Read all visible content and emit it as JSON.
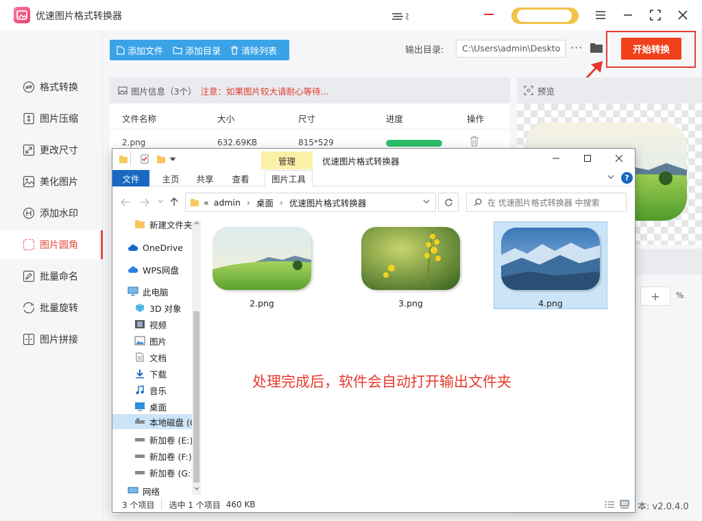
{
  "app": {
    "title": "优速图片格式转换器",
    "version_label": "本: v2.0.4.0"
  },
  "sidebar": {
    "items": [
      {
        "label": "格式转换",
        "icon": "convert-icon"
      },
      {
        "label": "图片压缩",
        "icon": "compress-icon"
      },
      {
        "label": "更改尺寸",
        "icon": "resize-icon"
      },
      {
        "label": "美化图片",
        "icon": "beautify-icon"
      },
      {
        "label": "添加水印",
        "icon": "watermark-icon"
      },
      {
        "label": "图片圆角",
        "icon": "round-corner-icon",
        "active": true
      },
      {
        "label": "批量命名",
        "icon": "rename-icon"
      },
      {
        "label": "批量旋转",
        "icon": "rotate-icon"
      },
      {
        "label": "图片拼接",
        "icon": "stitch-icon"
      }
    ]
  },
  "toolbar": {
    "add_file": "添加文件",
    "add_folder": "添加目录",
    "clear_list": "清除列表",
    "output_label": "输出目录:",
    "output_path": "C:\\Users\\admin\\Deskto",
    "more": "···",
    "start": "开始转换"
  },
  "file_table": {
    "info_title": "图片信息（3个）",
    "warning": "注意：如果图片较大请耐心等待...",
    "headers": [
      "文件名称",
      "大小",
      "尺寸",
      "进度",
      "操作"
    ],
    "rows": [
      {
        "name": "2.png",
        "size": "632.69KB",
        "dimensions": "815*529",
        "progress": 1.0
      }
    ]
  },
  "preview": {
    "title": "预览",
    "zoom_plus": "+",
    "zoom_unit": "%"
  },
  "explorer": {
    "manage_tab": "管理",
    "window_title": "优速图片格式转换器",
    "tabs": [
      "文件",
      "主页",
      "共享",
      "查看",
      "图片工具"
    ],
    "breadcrumb": [
      "«",
      "admin",
      "桌面",
      "优速图片格式转换器"
    ],
    "search_placeholder": "在 优速图片格式转换器 中搜索",
    "nav": [
      "新建文件夹",
      "OneDrive",
      "WPS网盘",
      "此电脑",
      "3D 对象",
      "视频",
      "图片",
      "文档",
      "下载",
      "音乐",
      "桌面",
      "本地磁盘 (C",
      "新加卷 (E:)",
      "新加卷 (F:)",
      "新加卷 (G:)",
      "网络"
    ],
    "files": [
      "2.png",
      "3.png",
      "4.png"
    ],
    "status": {
      "count": "3 个项目",
      "selected": "选中 1 个项目",
      "size": "460 KB"
    }
  },
  "annotation": "处理完成后，软件会自动打开输出文件夹",
  "colors": {
    "accent_red": "#e8473c",
    "toolbar_blue": "#3aa3e8",
    "start_button": "#f0401c",
    "progress_green": "#2dbd68"
  }
}
